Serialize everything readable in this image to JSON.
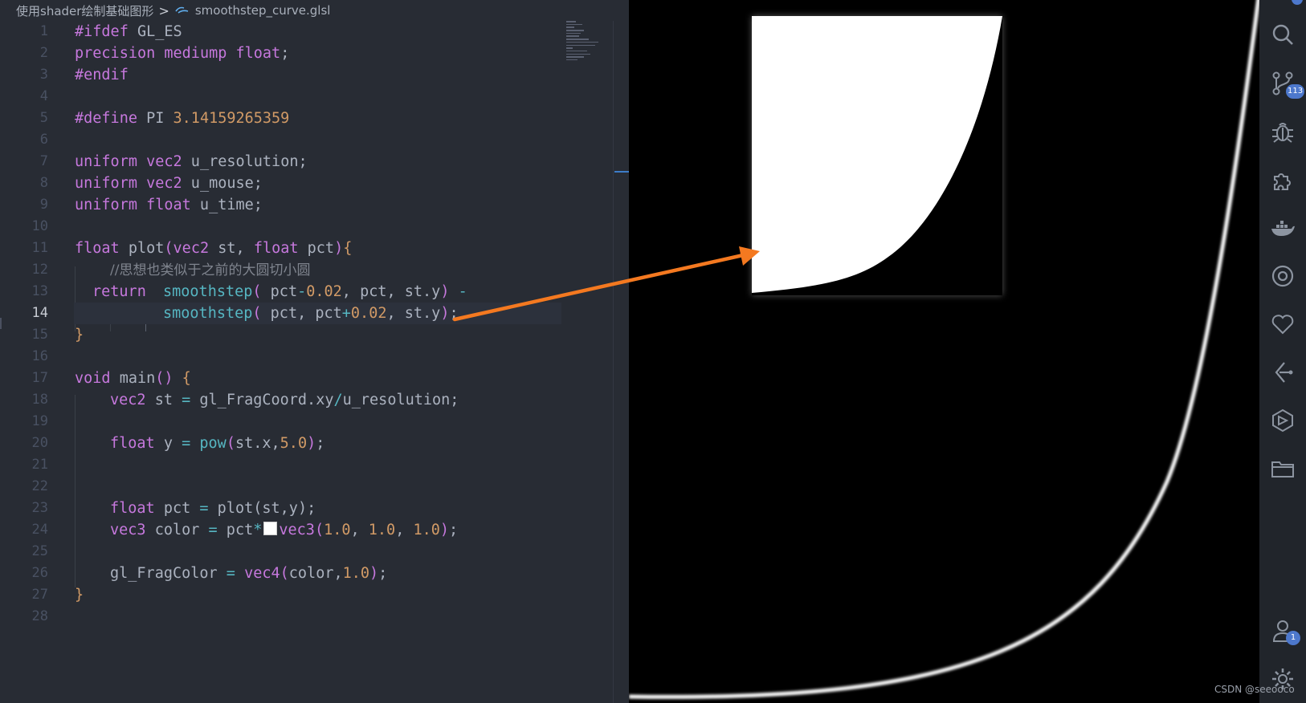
{
  "breadcrumb": {
    "folder": "使用shader绘制基础图形",
    "separator": ">",
    "file_icon": "glsl-file-icon",
    "file": "smoothstep_curve.glsl"
  },
  "editor": {
    "active_line": 14,
    "lines": [
      "1",
      "2",
      "3",
      "4",
      "5",
      "6",
      "7",
      "8",
      "9",
      "10",
      "11",
      "12",
      "13",
      "14",
      "15",
      "16",
      "17",
      "18",
      "19",
      "20",
      "21",
      "22",
      "23",
      "24",
      "25",
      "26",
      "27",
      "28"
    ],
    "code": {
      "l1_a": "#ifdef",
      "l1_b": " GL_ES",
      "l2_a": "precision",
      "l2_b": " mediump",
      "l2_c": " float",
      "l2_d": ";",
      "l3_a": "#endif",
      "l5_a": "#define",
      "l5_b": " PI ",
      "l5_c": "3.14159265359",
      "l7_a": "uniform",
      "l7_b": " vec2",
      "l7_c": " u_resolution;",
      "l8_a": "uniform",
      "l8_b": " vec2",
      "l8_c": " u_mouse;",
      "l9_a": "uniform",
      "l9_b": " float",
      "l9_c": " u_time;",
      "l11_a": "float",
      "l11_b": " plot",
      "l11_c": "(",
      "l11_d": "vec2",
      "l11_e": " st, ",
      "l11_f": "float",
      "l11_g": " pct",
      "l11_h": ")",
      "l11_i": "{",
      "l12_a": "//思想也类似于之前的大圆切小圆",
      "l13_a": "return",
      "l13_b": "smoothstep",
      "l13_c": "(",
      "l13_d": " pct",
      "l13_e": "-",
      "l13_f": "0.02",
      "l13_g": ", pct, st.y",
      "l13_h": ")",
      "l13_i": " -",
      "l14_a": "smoothstep",
      "l14_b": "(",
      "l14_c": " pct, pct",
      "l14_d": "+",
      "l14_e": "0.02",
      "l14_f": ", st.y",
      "l14_g": ")",
      "l14_h": ";",
      "l15_a": "}",
      "l17_a": "void",
      "l17_b": " main",
      "l17_c": "()",
      "l17_d": " {",
      "l18_a": "vec2",
      "l18_b": " st ",
      "l18_c": "=",
      "l18_d": " gl_FragCoord.xy",
      "l18_e": "/",
      "l18_f": "u_resolution;",
      "l20_a": "float",
      "l20_b": " y ",
      "l20_c": "=",
      "l20_d": " pow",
      "l20_e": "(",
      "l20_f": "st.x,",
      "l20_g": "5.0",
      "l20_h": ")",
      "l20_i": ";",
      "l23_a": "float",
      "l23_b": " pct ",
      "l23_c": "=",
      "l23_d": " plot",
      "l23_e": "(st,y);",
      "l24_a": "vec3",
      "l24_b": " color ",
      "l24_c": "=",
      "l24_d": " pct",
      "l24_e": "*",
      "l24_f": "vec3",
      "l24_g": "(",
      "l24_h": "1.0",
      "l24_i": ", ",
      "l24_j": "1.0",
      "l24_k": ", ",
      "l24_l": "1.0",
      "l24_m": ")",
      "l24_n": ";",
      "l26_a": "gl_FragColor",
      "l26_b": " =",
      "l26_c": " vec4",
      "l26_d": "(",
      "l26_e": "color,",
      "l26_f": "1.0",
      "l26_g": ")",
      "l26_h": ";",
      "l27_a": "}"
    }
  },
  "activity_bar": {
    "items": [
      {
        "icon": "search-icon"
      },
      {
        "icon": "source-control-icon",
        "badge": "113"
      },
      {
        "icon": "debug-icon"
      },
      {
        "icon": "extensions-icon"
      },
      {
        "icon": "docker-icon"
      },
      {
        "icon": "target-icon"
      },
      {
        "icon": "heart-icon"
      },
      {
        "icon": "gitlens-icon"
      },
      {
        "icon": "cube-icon"
      },
      {
        "icon": "folder-icon"
      },
      {
        "icon": "account-icon",
        "badge": "1"
      },
      {
        "icon": "settings-gear-icon"
      }
    ]
  },
  "watermark": "CSDN @seeooco",
  "colors": {
    "editor_bg": "#282c34",
    "keyword": "#c678dd",
    "function": "#56b6c2",
    "number": "#d19a66",
    "arrow": "#f47920",
    "badge": "#4d78cc"
  }
}
